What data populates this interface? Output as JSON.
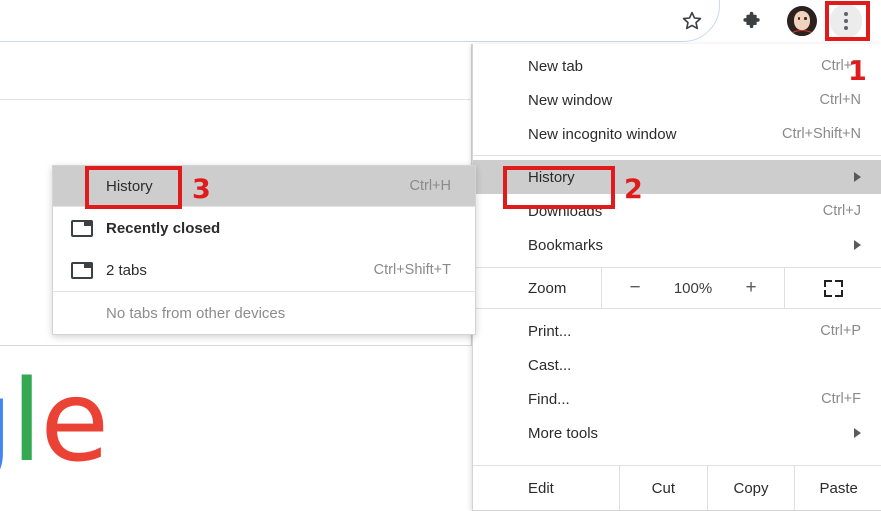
{
  "toolbar": {
    "star_icon": "bookmark-star-icon",
    "extensions_icon": "puzzle-piece-icon",
    "avatar_label": "profile-avatar",
    "menu_icon": "three-dot-menu-icon"
  },
  "logo": {
    "part_g": "g",
    "part_l": "l",
    "part_e": "e"
  },
  "menu": {
    "items": [
      {
        "label": "New tab",
        "accel": "Ctrl+T",
        "type": "item"
      },
      {
        "label": "New window",
        "accel": "Ctrl+N",
        "type": "item"
      },
      {
        "label": "New incognito window",
        "accel": "Ctrl+Shift+N",
        "type": "item"
      },
      {
        "label": "History",
        "accel": "",
        "type": "submenu",
        "highlighted": true
      },
      {
        "label": "Downloads",
        "accel": "Ctrl+J",
        "type": "item"
      },
      {
        "label": "Bookmarks",
        "accel": "",
        "type": "submenu"
      },
      {
        "label": "Print...",
        "accel": "Ctrl+P",
        "type": "item"
      },
      {
        "label": "Cast...",
        "accel": "",
        "type": "item"
      },
      {
        "label": "Find...",
        "accel": "Ctrl+F",
        "type": "item"
      },
      {
        "label": "More tools",
        "accel": "",
        "type": "submenu"
      }
    ],
    "zoom": {
      "label": "Zoom",
      "minus": "−",
      "percent": "100%",
      "plus": "+",
      "fullscreen_icon": "fullscreen-icon"
    },
    "edit_row": {
      "label": "Edit",
      "cut": "Cut",
      "copy": "Copy",
      "paste": "Paste"
    }
  },
  "submenu": {
    "title": "History",
    "title_accel": "Ctrl+H",
    "recently_closed": "Recently closed",
    "tabs_entry": "2 tabs",
    "tabs_accel": "Ctrl+Shift+T",
    "no_other_devices": "No tabs from other devices"
  },
  "annotations": {
    "marker_1": "1",
    "marker_2": "2",
    "marker_3": "3",
    "color": "#e01b1b"
  }
}
